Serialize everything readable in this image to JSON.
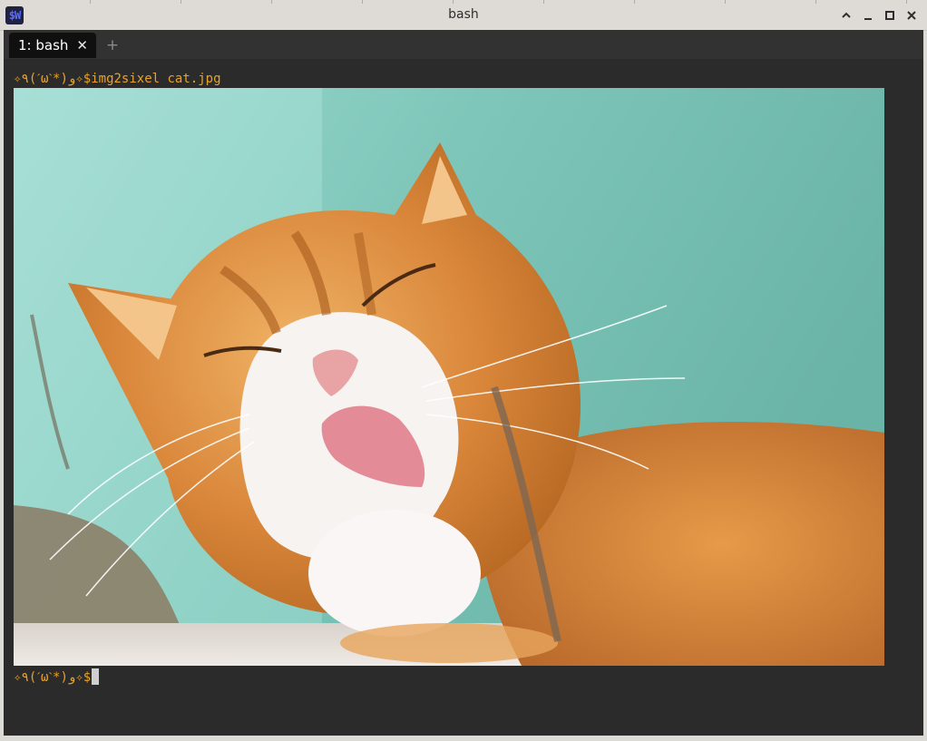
{
  "window": {
    "title": "bash",
    "app_icon_text": "$W",
    "controls": [
      "chevron-up-icon",
      "minimize-icon",
      "maximize-icon",
      "close-icon"
    ]
  },
  "tabs": [
    {
      "label": "1: bash",
      "close": "✕",
      "active": true
    }
  ],
  "new_tab_label": "+",
  "terminal": {
    "prompt": "✧٩(ˊωˋ*)و✧$",
    "command": "img2sixel cat.jpg",
    "image_alt": "cat.jpg"
  },
  "colors": {
    "prompt": "#e9a22a",
    "terminal_bg": "#2b2b2b",
    "tab_active_bg": "#101010"
  }
}
